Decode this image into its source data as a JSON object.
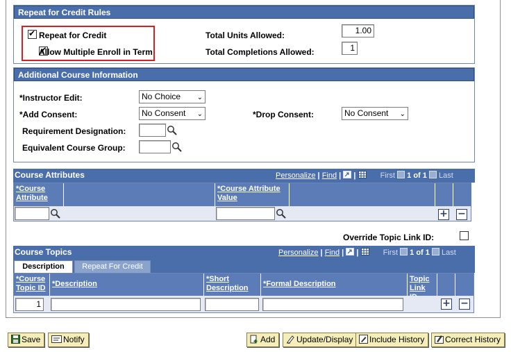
{
  "repeat_rules": {
    "title": "Repeat for Credit Rules",
    "repeat_for_credit": {
      "label": "Repeat for Credit",
      "checked": true
    },
    "allow_multiple_enroll": {
      "label": "Allow Multiple Enroll in Term",
      "checked": true
    },
    "total_units_label": "Total Units Allowed:",
    "total_units_value": "1.00",
    "total_completions_label": "Total Completions Allowed:",
    "total_completions_value": "1"
  },
  "additional": {
    "title": "Additional Course Information",
    "instructor_edit_label": "*Instructor Edit:",
    "instructor_edit_value": "No Choice",
    "add_consent_label": "*Add Consent:",
    "add_consent_value": "No Consent",
    "drop_consent_label": "*Drop Consent:",
    "drop_consent_value": "No Consent",
    "requirement_label": "Requirement Designation:",
    "equivalent_label": "Equivalent Course Group:"
  },
  "attributes": {
    "title": "Course Attributes",
    "personalize": "Personalize",
    "find": "Find",
    "first": "First",
    "count": "1 of 1",
    "last": "Last",
    "col1": "*Course Attribute",
    "col2": "*Course Attribute Value"
  },
  "override": {
    "label": "Override Topic Link ID:",
    "checked": false
  },
  "topics": {
    "title": "Course Topics",
    "personalize": "Personalize",
    "find": "Find",
    "first": "First",
    "count": "1 of 1",
    "last": "Last",
    "tabs": [
      "Description",
      "Repeat For Credit"
    ],
    "col_topic_id": "*Course Topic ID",
    "col_description": "*Description",
    "col_short": "*Short Description",
    "col_formal": "*Formal Description",
    "col_link": "Topic Link ID",
    "topic_id_value": "1"
  },
  "buttons": {
    "save": "Save",
    "notify": "Notify",
    "add": "Add",
    "update": "Update/Display",
    "include_history": "Include History",
    "correct_history": "Correct History"
  },
  "colors": {
    "header": "#4a6ea9",
    "button_bg": "#f5eeb8",
    "highlight": "#d42020"
  }
}
